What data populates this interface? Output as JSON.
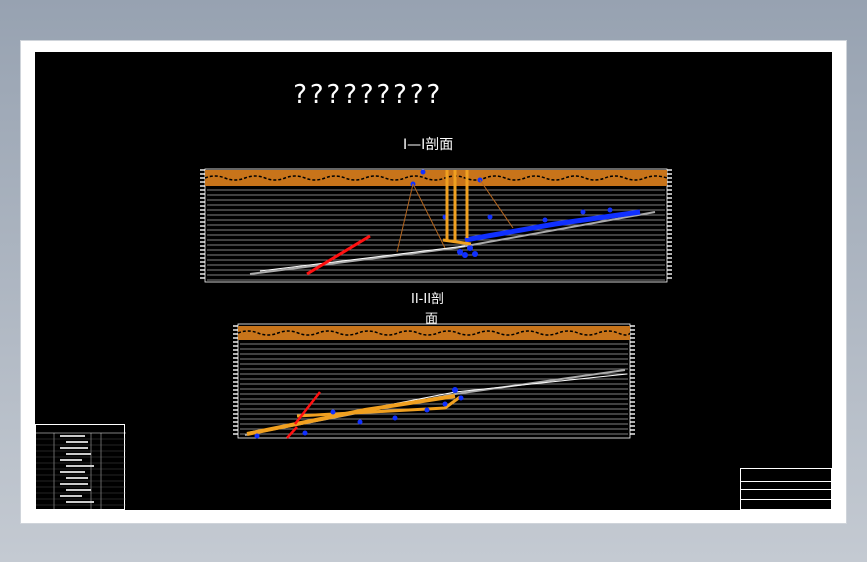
{
  "drawing": {
    "main_title": "?????????",
    "section_1": {
      "title": "I—I剖面"
    },
    "section_2": {
      "title_line1": "II-II剖",
      "title_line2": "面"
    },
    "legend_table": {
      "header": ""
    },
    "title_block": {
      "label": ""
    }
  },
  "colors": {
    "background_outer": "#97a2b1",
    "paper": "#ffffff",
    "drawing_bg": "#000000",
    "terrain_fill": "#c8741a",
    "grid_line": "#ffffff",
    "seam_blue": "#1030ff",
    "shaft_orange": "#f0a020",
    "fault_red": "#ff1010",
    "strata_line": "#b5651d"
  }
}
